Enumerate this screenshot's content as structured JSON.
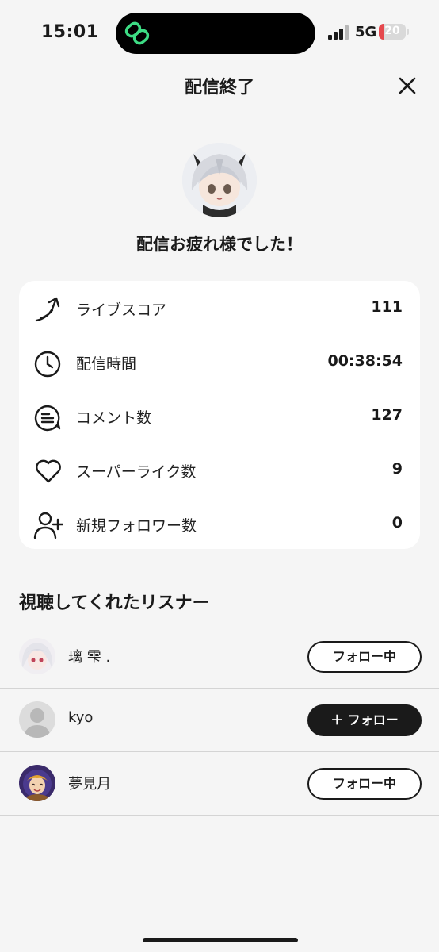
{
  "status_bar": {
    "time": "15:01",
    "network": "5G",
    "battery_level": "20",
    "battery_fraction": 0.2,
    "signal_bars_active": 3,
    "signal_bars_total": 4,
    "icons": [
      "link-icon",
      "signal-icon",
      "battery-icon"
    ]
  },
  "header": {
    "title": "配信終了",
    "close_icon": "close-icon"
  },
  "summary": {
    "thanks_message": "配信お疲れ様でした！"
  },
  "stats": [
    {
      "icon": "trend-arrow-icon",
      "label": "ライブスコア",
      "value": "111"
    },
    {
      "icon": "clock-icon",
      "label": "配信時間",
      "value": "00:38:54"
    },
    {
      "icon": "comment-icon",
      "label": "コメント数",
      "value": "127"
    },
    {
      "icon": "heart-icon",
      "label": "スーパーライク数",
      "value": "9"
    },
    {
      "icon": "add-user-icon",
      "label": "新規フォロワー数",
      "value": "0"
    }
  ],
  "listeners": {
    "title": "視聴してくれたリスナー",
    "items": [
      {
        "name": "璃 雫 .",
        "button_label": "フォロー中",
        "following": true
      },
      {
        "name": "kyo",
        "button_label": "＋ フォロー",
        "following": false
      },
      {
        "name": "夢見月",
        "button_label": "フォロー中",
        "following": true
      }
    ]
  },
  "colors": {
    "background": "#f5f5f5",
    "card": "#ffffff",
    "text": "#1a1a1a",
    "accent_green": "#3ddc84",
    "battery_red": "#e5484d"
  }
}
